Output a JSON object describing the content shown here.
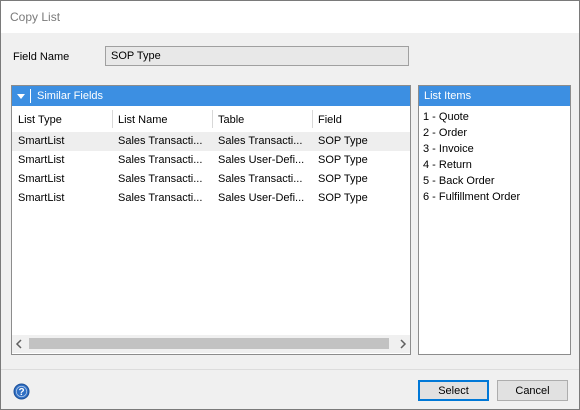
{
  "window": {
    "title": "Copy List"
  },
  "field": {
    "label": "Field Name",
    "value": "SOP Type"
  },
  "similar_fields": {
    "header": "Similar Fields",
    "columns": [
      "List Type",
      "List Name",
      "Table",
      "Field"
    ],
    "rows": [
      [
        "SmartList",
        "Sales Transacti...",
        "Sales Transacti...",
        "SOP Type"
      ],
      [
        "SmartList",
        "Sales Transacti...",
        "Sales User-Defi...",
        "SOP Type"
      ],
      [
        "SmartList",
        "Sales Transacti...",
        "Sales Transacti...",
        "SOP Type"
      ],
      [
        "SmartList",
        "Sales Transacti...",
        "Sales User-Defi...",
        "SOP Type"
      ]
    ]
  },
  "list_items": {
    "header": "List Items",
    "items": [
      "1 - Quote",
      "2 - Order",
      "3 - Invoice",
      "4 - Return",
      "5 - Back Order",
      "6 - Fulfillment Order"
    ]
  },
  "buttons": {
    "select": "Select",
    "cancel": "Cancel"
  },
  "colors": {
    "accent": "#3c8fe2",
    "selected_row": "#eeeeee"
  },
  "icons": {
    "collapse": "chevron-down-icon",
    "help": "help-icon",
    "scroll_left": "arrow-left-icon",
    "scroll_right": "arrow-right-icon"
  }
}
